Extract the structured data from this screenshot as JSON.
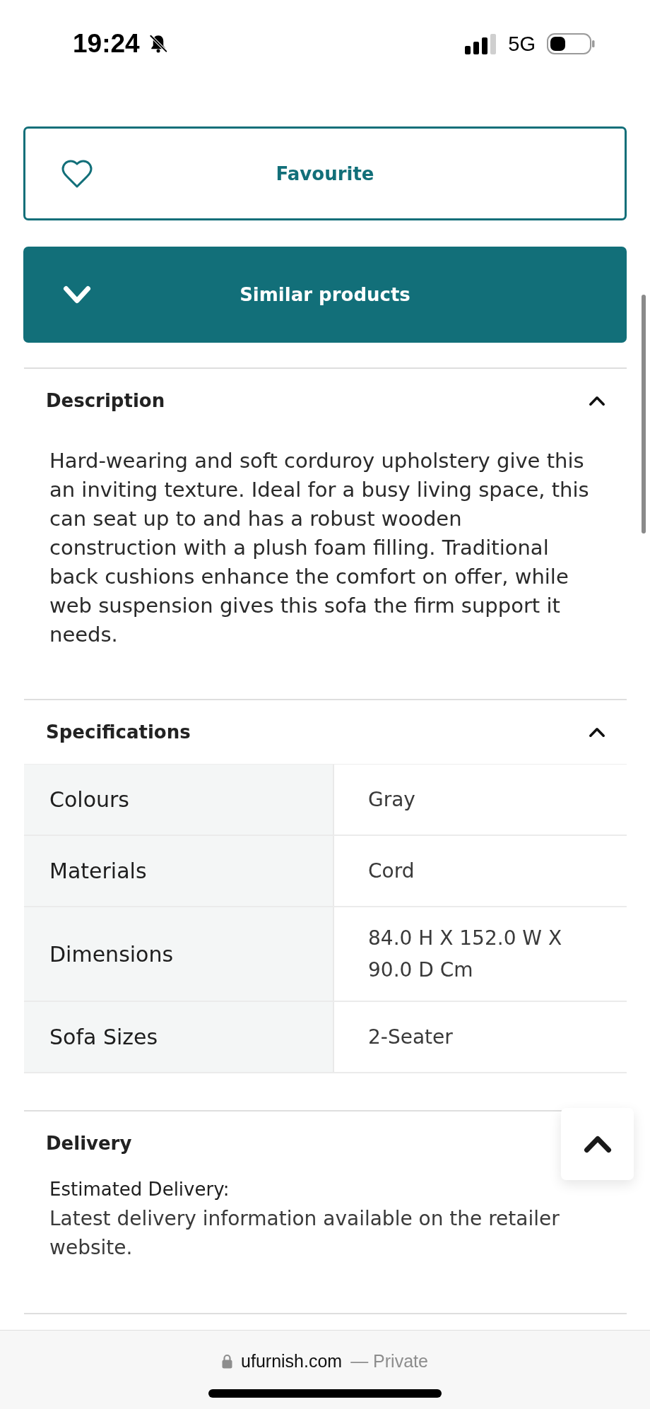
{
  "status_bar": {
    "time": "19:24",
    "network": "5G"
  },
  "favourite_button": {
    "label": "Favourite"
  },
  "similar_products": {
    "label": "Similar products",
    "expanded": false
  },
  "sections": [
    {
      "kind": "text",
      "title": "Description",
      "expanded": true,
      "text": "Hard-wearing and soft corduroy upholstery give this an inviting texture. Ideal for a busy living space, this can seat up to and has a robust wooden construction with a plush foam filling. Traditional back cushions enhance the comfort on offer, while web suspension gives this sofa the firm support it needs."
    },
    {
      "kind": "table",
      "title": "Specifications",
      "expanded": true,
      "rows": [
        {
          "label": "Colours",
          "value": "Gray"
        },
        {
          "label": "Materials",
          "value": "Cord"
        },
        {
          "label": "Dimensions",
          "value": "84.0 H X 152.0 W X 90.0 D Cm"
        },
        {
          "label": "Sofa Sizes",
          "value": "2-Seater"
        }
      ]
    },
    {
      "kind": "delivery",
      "title": "Delivery",
      "subtitle": "Estimated Delivery:",
      "text": "Latest delivery information available on the retailer website."
    }
  ],
  "browser_bar": {
    "domain": "ufurnish.com",
    "mode": "— Private"
  }
}
